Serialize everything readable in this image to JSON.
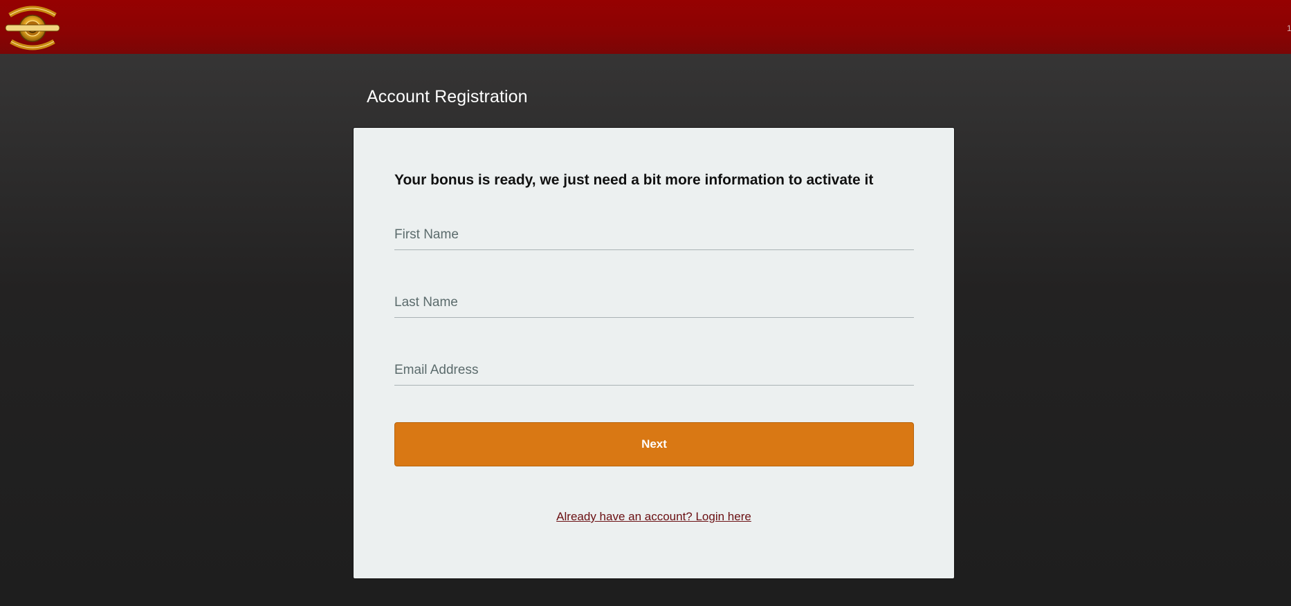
{
  "brand": {
    "logo_alt": "Golden Tiger",
    "colors": {
      "header": "#960101",
      "accent": "#d97814",
      "card": "#ecf0f0",
      "link": "#6a0f12"
    }
  },
  "header": {
    "edge_text": "1"
  },
  "page": {
    "title": "Account Registration"
  },
  "form": {
    "heading": "Your bonus is ready, we just need a bit more information to activate it",
    "first_name": {
      "placeholder": "First Name",
      "value": ""
    },
    "last_name": {
      "placeholder": "Last Name",
      "value": ""
    },
    "email": {
      "placeholder": "Email Address",
      "value": ""
    },
    "next_label": "Next",
    "login_link": "Already have an account? Login here"
  }
}
